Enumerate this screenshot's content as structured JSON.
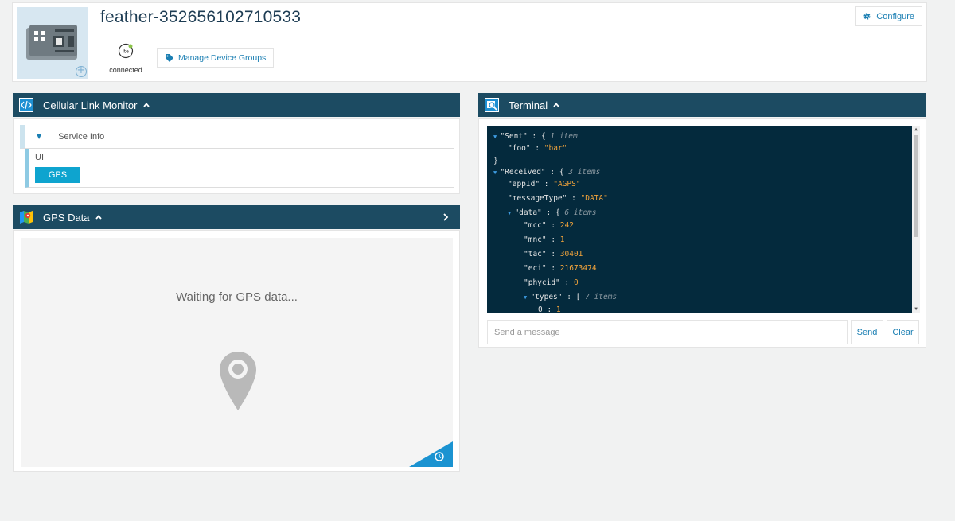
{
  "device": {
    "title": "feather-352656102710533",
    "status_label": "connected",
    "status_icon": "lte-icon",
    "manage_groups_label": "Manage Device Groups",
    "configure_label": "Configure"
  },
  "cellular_monitor": {
    "title": "Cellular Link Monitor",
    "service_info_label": "Service Info",
    "ui_label": "UI",
    "gps_button_label": "GPS"
  },
  "gps_panel": {
    "title": "GPS Data",
    "waiting_text": "Waiting for GPS data..."
  },
  "terminal": {
    "title": "Terminal",
    "input_placeholder": "Send a message",
    "send_label": "Send",
    "clear_label": "Clear",
    "lines": [
      {
        "toggle": true,
        "key": "\"Sent\"",
        "sep": " : ",
        "brace": "{ ",
        "comment": "1 item",
        "value": ""
      },
      {
        "toggle": false,
        "key": "\"foo\"",
        "sep": " : ",
        "brace": "",
        "comment": "",
        "value": "\"bar\""
      },
      {
        "toggle": false,
        "key": "",
        "sep": "",
        "brace": "}",
        "comment": "",
        "value": ""
      },
      {
        "toggle": true,
        "key": "\"Received\"",
        "sep": " : ",
        "brace": "{ ",
        "comment": "3 items",
        "value": ""
      },
      {
        "toggle": false,
        "key": "\"appId\"",
        "sep": " : ",
        "brace": "",
        "comment": "",
        "value": "\"AGPS\""
      },
      {
        "toggle": false,
        "key": "\"messageType\"",
        "sep": " : ",
        "brace": "",
        "comment": "",
        "value": "\"DATA\""
      },
      {
        "toggle": true,
        "key": "\"data\"",
        "sep": " : ",
        "brace": "{ ",
        "comment": "6 items",
        "value": ""
      },
      {
        "toggle": false,
        "key": "\"mcc\"",
        "sep": " : ",
        "brace": "",
        "comment": "",
        "value": "242"
      },
      {
        "toggle": false,
        "key": "\"mnc\"",
        "sep": " : ",
        "brace": "",
        "comment": "",
        "value": "1"
      },
      {
        "toggle": false,
        "key": "\"tac\"",
        "sep": " : ",
        "brace": "",
        "comment": "",
        "value": "30401"
      },
      {
        "toggle": false,
        "key": "\"eci\"",
        "sep": " : ",
        "brace": "",
        "comment": "",
        "value": "21673474"
      },
      {
        "toggle": false,
        "key": "\"phycid\"",
        "sep": " : ",
        "brace": "",
        "comment": "",
        "value": "0"
      },
      {
        "toggle": true,
        "key": "\"types\"",
        "sep": " : ",
        "brace": "[ ",
        "comment": "7 items",
        "value": ""
      },
      {
        "toggle": false,
        "key": "0",
        "sep": " : ",
        "brace": "",
        "comment": "",
        "value": "1"
      }
    ]
  },
  "colors": {
    "panel_header": "#1c4b62",
    "accent": "#0ea4cf",
    "link": "#1b7fb3",
    "terminal_bg": "#042a3d",
    "json_value": "#f1a33b"
  }
}
